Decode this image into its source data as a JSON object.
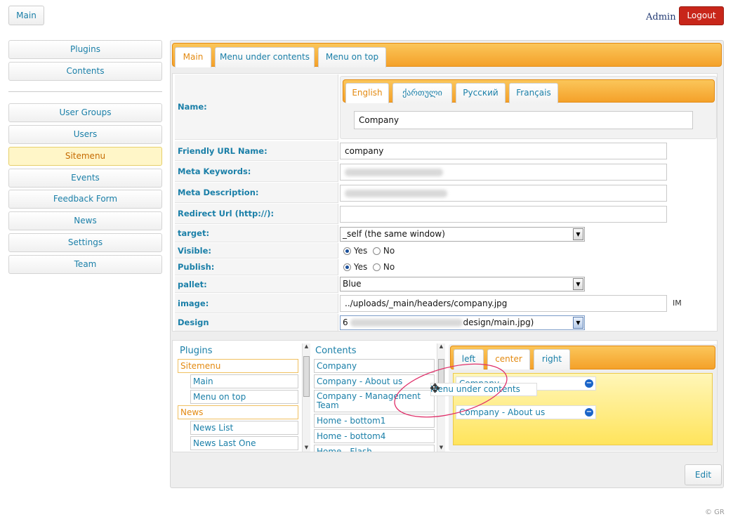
{
  "header": {
    "main_label": "Main",
    "admin_label": "Admin",
    "logout_label": "Logout"
  },
  "sidebar": {
    "top_items": [
      {
        "label": "Plugins"
      },
      {
        "label": "Contents"
      }
    ],
    "items": [
      {
        "label": "User Groups"
      },
      {
        "label": "Users"
      },
      {
        "label": "Sitemenu",
        "active": true
      },
      {
        "label": "Events"
      },
      {
        "label": "Feedback Form"
      },
      {
        "label": "News"
      },
      {
        "label": "Settings"
      },
      {
        "label": "Team"
      }
    ]
  },
  "main_tabs": [
    {
      "label": "Main",
      "active": true
    },
    {
      "label": "Menu under contents"
    },
    {
      "label": "Menu on top"
    }
  ],
  "lang_tabs": [
    {
      "label": "English",
      "active": true
    },
    {
      "label": "ქართული"
    },
    {
      "label": "Русский"
    },
    {
      "label": "Français"
    }
  ],
  "form": {
    "name_label": "Name:",
    "name_value": "Company",
    "url_label": "Friendly URL Name:",
    "url_value": "company",
    "keywords_label": "Meta Keywords:",
    "description_label": "Meta Description:",
    "redirect_label": "Redirect Url (http://):",
    "target_label": "target:",
    "target_value": "_self (the same window)",
    "visible_label": "Visible:",
    "publish_label": "Publish:",
    "yes_label": "Yes",
    "no_label": "No",
    "visible_value": "Yes",
    "publish_value": "Yes",
    "pallet_label": "pallet:",
    "pallet_value": "Blue",
    "image_label": "image:",
    "image_value": "../uploads/_main/headers/company.jpg",
    "image_suffix": "IM",
    "design_label": "Design",
    "design_prefix": "6",
    "design_suffix": "design/main.jpg)"
  },
  "plugins_col": {
    "title": "Plugins",
    "items": [
      {
        "label": "Sitemenu",
        "group": true
      },
      {
        "label": "Main"
      },
      {
        "label": "Menu on top"
      },
      {
        "label": "News",
        "group": true
      },
      {
        "label": "News List"
      },
      {
        "label": "News Last One"
      }
    ]
  },
  "contents_col": {
    "title": "Contents",
    "items": [
      {
        "label": "Company"
      },
      {
        "label": "Company - About us"
      },
      {
        "label": "Company - Management Team"
      },
      {
        "label": "Home - bottom1"
      },
      {
        "label": "Home - bottom4"
      },
      {
        "label": "Home - Flash"
      }
    ]
  },
  "position_tabs": [
    {
      "label": "left"
    },
    {
      "label": "center",
      "active": true
    },
    {
      "label": "right"
    }
  ],
  "drop_zone": {
    "items": [
      {
        "label": "Company"
      },
      {
        "label": "Company - About us"
      }
    ],
    "dragging_label": "Menu under contents"
  },
  "edit_label": "Edit",
  "footer": "© GR"
}
